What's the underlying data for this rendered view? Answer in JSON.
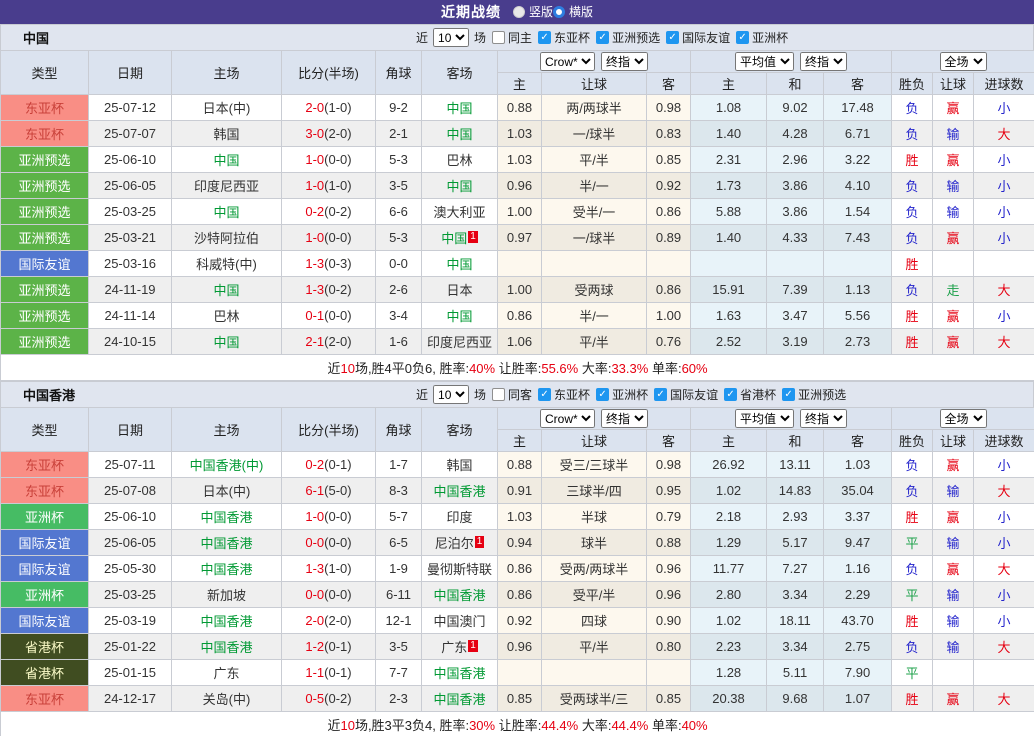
{
  "titlebar": {
    "title": "近期战绩",
    "radios": [
      {
        "label": "竖版",
        "checked": false
      },
      {
        "label": "横版",
        "checked": true
      }
    ]
  },
  "columns": {
    "left": [
      "类型",
      "日期",
      "主场",
      "比分(半场)",
      "角球",
      "客场"
    ],
    "groups": [
      {
        "selects": [
          "Crow*",
          "终指"
        ],
        "subs": [
          "主",
          "让球",
          "客"
        ]
      },
      {
        "selects": [
          "平均值",
          "终指"
        ],
        "subs": [
          "主",
          "和",
          "客"
        ]
      },
      {
        "selects": [
          "全场"
        ],
        "subs": [
          "胜负",
          "让球",
          "进球数"
        ]
      }
    ]
  },
  "type_colors": {
    "东亚杯": {
      "bg": "#f98e85",
      "fg": "#c9413a"
    },
    "亚洲预选": {
      "bg": "#5cb348",
      "fg": "#ffffff"
    },
    "亚洲杯": {
      "bg": "#46bc64",
      "fg": "#ffffff"
    },
    "国际友谊": {
      "bg": "#5377d0",
      "fg": "#ffffff"
    },
    "省港杯": {
      "bg": "#404d21",
      "fg": "#fbfbc8"
    }
  },
  "value_colors": {
    "胜": "red",
    "负": "blue",
    "平": "green",
    "赢": "red",
    "输": "blue",
    "走": "green",
    "大": "red",
    "小": "blue"
  },
  "sections": [
    {
      "team": "中国",
      "filter": {
        "near": "近",
        "count": "10",
        "unit": "场",
        "same": {
          "label": "同主",
          "checked": false
        },
        "comps": [
          "东亚杯",
          "亚洲预选",
          "国际友谊",
          "亚洲杯"
        ]
      },
      "rows": [
        {
          "t": "东亚杯",
          "d": "25-07-12",
          "h": "日本(中)",
          "hg": false,
          "hb": "",
          "s": "2-0",
          "sh": "(1-0)",
          "ck": "9-2",
          "a": "中国",
          "ag": true,
          "ab": "",
          "o1": "0.88",
          "o2": "两/两球半",
          "o3": "0.98",
          "v1": "1.08",
          "v2": "9.02",
          "v3": "17.48",
          "r1": "负",
          "r2": "赢",
          "r3": "小"
        },
        {
          "t": "东亚杯",
          "d": "25-07-07",
          "h": "韩国",
          "hg": false,
          "hb": "",
          "s": "3-0",
          "sh": "(2-0)",
          "ck": "2-1",
          "a": "中国",
          "ag": true,
          "ab": "",
          "o1": "1.03",
          "o2": "一/球半",
          "o3": "0.83",
          "v1": "1.40",
          "v2": "4.28",
          "v3": "6.71",
          "r1": "负",
          "r2": "输",
          "r3": "大"
        },
        {
          "t": "亚洲预选",
          "d": "25-06-10",
          "h": "中国",
          "hg": true,
          "hb": "",
          "s": "1-0",
          "sh": "(0-0)",
          "ck": "5-3",
          "a": "巴林",
          "ag": false,
          "ab": "",
          "o1": "1.03",
          "o2": "平/半",
          "o3": "0.85",
          "v1": "2.31",
          "v2": "2.96",
          "v3": "3.22",
          "r1": "胜",
          "r2": "赢",
          "r3": "小"
        },
        {
          "t": "亚洲预选",
          "d": "25-06-05",
          "h": "印度尼西亚",
          "hg": false,
          "hb": "",
          "s": "1-0",
          "sh": "(1-0)",
          "ck": "3-5",
          "a": "中国",
          "ag": true,
          "ab": "",
          "o1": "0.96",
          "o2": "半/一",
          "o3": "0.92",
          "v1": "1.73",
          "v2": "3.86",
          "v3": "4.10",
          "r1": "负",
          "r2": "输",
          "r3": "小"
        },
        {
          "t": "亚洲预选",
          "d": "25-03-25",
          "h": "中国",
          "hg": true,
          "hb": "",
          "s": "0-2",
          "sh": "(0-2)",
          "ck": "6-6",
          "a": "澳大利亚",
          "ag": false,
          "ab": "",
          "o1": "1.00",
          "o2": "受半/一",
          "o3": "0.86",
          "v1": "5.88",
          "v2": "3.86",
          "v3": "1.54",
          "r1": "负",
          "r2": "输",
          "r3": "小"
        },
        {
          "t": "亚洲预选",
          "d": "25-03-21",
          "h": "沙特阿拉伯",
          "hg": false,
          "hb": "",
          "s": "1-0",
          "sh": "(0-0)",
          "ck": "5-3",
          "a": "中国",
          "ag": true,
          "ab": "1",
          "o1": "0.97",
          "o2": "一/球半",
          "o3": "0.89",
          "v1": "1.40",
          "v2": "4.33",
          "v3": "7.43",
          "r1": "负",
          "r2": "赢",
          "r3": "小"
        },
        {
          "t": "国际友谊",
          "d": "25-03-16",
          "h": "科威特(中)",
          "hg": false,
          "hb": "",
          "s": "1-3",
          "sh": "(0-3)",
          "ck": "0-0",
          "a": "中国",
          "ag": true,
          "ab": "",
          "o1": "",
          "o2": "",
          "o3": "",
          "v1": "",
          "v2": "",
          "v3": "",
          "r1": "胜",
          "r2": "",
          "r3": ""
        },
        {
          "t": "亚洲预选",
          "d": "24-11-19",
          "h": "中国",
          "hg": true,
          "hb": "",
          "s": "1-3",
          "sh": "(0-2)",
          "ck": "2-6",
          "a": "日本",
          "ag": false,
          "ab": "",
          "o1": "1.00",
          "o2": "受两球",
          "o3": "0.86",
          "v1": "15.91",
          "v2": "7.39",
          "v3": "1.13",
          "r1": "负",
          "r2": "走",
          "r3": "大"
        },
        {
          "t": "亚洲预选",
          "d": "24-11-14",
          "h": "巴林",
          "hg": false,
          "hb": "",
          "s": "0-1",
          "sh": "(0-0)",
          "ck": "3-4",
          "a": "中国",
          "ag": true,
          "ab": "",
          "o1": "0.86",
          "o2": "半/一",
          "o3": "1.00",
          "v1": "1.63",
          "v2": "3.47",
          "v3": "5.56",
          "r1": "胜",
          "r2": "赢",
          "r3": "小"
        },
        {
          "t": "亚洲预选",
          "d": "24-10-15",
          "h": "中国",
          "hg": true,
          "hb": "",
          "s": "2-1",
          "sh": "(2-0)",
          "ck": "1-6",
          "a": "印度尼西亚",
          "ag": false,
          "ab": "",
          "o1": "1.06",
          "o2": "平/半",
          "o3": "0.76",
          "v1": "2.52",
          "v2": "3.19",
          "v3": "2.73",
          "r1": "胜",
          "r2": "赢",
          "r3": "大"
        }
      ],
      "summary": [
        {
          "text": "近",
          "red": false
        },
        {
          "text": "10",
          "red": true
        },
        {
          "text": "场,胜4平0负6, 胜率:",
          "red": false
        },
        {
          "text": "40%",
          "red": true
        },
        {
          "text": " 让胜率:",
          "red": false
        },
        {
          "text": "55.6%",
          "red": true
        },
        {
          "text": " 大率:",
          "red": false
        },
        {
          "text": "33.3%",
          "red": true
        },
        {
          "text": " 单率:",
          "red": false
        },
        {
          "text": "60%",
          "red": true
        }
      ]
    },
    {
      "team": "中国香港",
      "filter": {
        "near": "近",
        "count": "10",
        "unit": "场",
        "same": {
          "label": "同客",
          "checked": false
        },
        "comps": [
          "东亚杯",
          "亚洲杯",
          "国际友谊",
          "省港杯",
          "亚洲预选"
        ]
      },
      "rows": [
        {
          "t": "东亚杯",
          "d": "25-07-11",
          "h": "中国香港(中)",
          "hg": true,
          "hb": "",
          "s": "0-2",
          "sh": "(0-1)",
          "ck": "1-7",
          "a": "韩国",
          "ag": false,
          "ab": "",
          "o1": "0.88",
          "o2": "受三/三球半",
          "o3": "0.98",
          "v1": "26.92",
          "v2": "13.11",
          "v3": "1.03",
          "r1": "负",
          "r2": "赢",
          "r3": "小"
        },
        {
          "t": "东亚杯",
          "d": "25-07-08",
          "h": "日本(中)",
          "hg": false,
          "hb": "",
          "s": "6-1",
          "sh": "(5-0)",
          "ck": "8-3",
          "a": "中国香港",
          "ag": true,
          "ab": "",
          "o1": "0.91",
          "o2": "三球半/四",
          "o3": "0.95",
          "v1": "1.02",
          "v2": "14.83",
          "v3": "35.04",
          "r1": "负",
          "r2": "输",
          "r3": "大"
        },
        {
          "t": "亚洲杯",
          "d": "25-06-10",
          "h": "中国香港",
          "hg": true,
          "hb": "",
          "s": "1-0",
          "sh": "(0-0)",
          "ck": "5-7",
          "a": "印度",
          "ag": false,
          "ab": "",
          "o1": "1.03",
          "o2": "半球",
          "o3": "0.79",
          "v1": "2.18",
          "v2": "2.93",
          "v3": "3.37",
          "r1": "胜",
          "r2": "赢",
          "r3": "小"
        },
        {
          "t": "国际友谊",
          "d": "25-06-05",
          "h": "中国香港",
          "hg": true,
          "hb": "",
          "s": "0-0",
          "sh": "(0-0)",
          "ck": "6-5",
          "a": "尼泊尔",
          "ag": false,
          "ab": "1",
          "o1": "0.94",
          "o2": "球半",
          "o3": "0.88",
          "v1": "1.29",
          "v2": "5.17",
          "v3": "9.47",
          "r1": "平",
          "r2": "输",
          "r3": "小"
        },
        {
          "t": "国际友谊",
          "d": "25-05-30",
          "h": "中国香港",
          "hg": true,
          "hb": "",
          "s": "1-3",
          "sh": "(1-0)",
          "ck": "1-9",
          "a": "曼彻斯特联",
          "ag": false,
          "ab": "",
          "o1": "0.86",
          "o2": "受两/两球半",
          "o3": "0.96",
          "v1": "11.77",
          "v2": "7.27",
          "v3": "1.16",
          "r1": "负",
          "r2": "赢",
          "r3": "大"
        },
        {
          "t": "亚洲杯",
          "d": "25-03-25",
          "h": "新加坡",
          "hg": false,
          "hb": "",
          "s": "0-0",
          "sh": "(0-0)",
          "ck": "6-11",
          "a": "中国香港",
          "ag": true,
          "ab": "",
          "o1": "0.86",
          "o2": "受平/半",
          "o3": "0.96",
          "v1": "2.80",
          "v2": "3.34",
          "v3": "2.29",
          "r1": "平",
          "r2": "输",
          "r3": "小"
        },
        {
          "t": "国际友谊",
          "d": "25-03-19",
          "h": "中国香港",
          "hg": true,
          "hb": "",
          "s": "2-0",
          "sh": "(2-0)",
          "ck": "12-1",
          "a": "中国澳门",
          "ag": false,
          "ab": "",
          "o1": "0.92",
          "o2": "四球",
          "o3": "0.90",
          "v1": "1.02",
          "v2": "18.11",
          "v3": "43.70",
          "r1": "胜",
          "r2": "输",
          "r3": "小"
        },
        {
          "t": "省港杯",
          "d": "25-01-22",
          "h": "中国香港",
          "hg": true,
          "hb": "",
          "s": "1-2",
          "sh": "(0-1)",
          "ck": "3-5",
          "a": "广东",
          "ag": false,
          "ab": "1",
          "o1": "0.96",
          "o2": "平/半",
          "o3": "0.80",
          "v1": "2.23",
          "v2": "3.34",
          "v3": "2.75",
          "r1": "负",
          "r2": "输",
          "r3": "大"
        },
        {
          "t": "省港杯",
          "d": "25-01-15",
          "h": "广东",
          "hg": false,
          "hb": "",
          "s": "1-1",
          "sh": "(0-1)",
          "ck": "7-7",
          "a": "中国香港",
          "ag": true,
          "ab": "",
          "o1": "",
          "o2": "",
          "o3": "",
          "v1": "1.28",
          "v2": "5.11",
          "v3": "7.90",
          "r1": "平",
          "r2": "",
          "r3": ""
        },
        {
          "t": "东亚杯",
          "d": "24-12-17",
          "h": "关岛(中)",
          "hg": false,
          "hb": "",
          "s": "0-5",
          "sh": "(0-2)",
          "ck": "2-3",
          "a": "中国香港",
          "ag": true,
          "ab": "",
          "o1": "0.85",
          "o2": "受两球半/三",
          "o3": "0.85",
          "v1": "20.38",
          "v2": "9.68",
          "v3": "1.07",
          "r1": "胜",
          "r2": "赢",
          "r3": "大"
        }
      ],
      "summary": [
        {
          "text": "近",
          "red": false
        },
        {
          "text": "10",
          "red": true
        },
        {
          "text": "场,胜3平3负4, 胜率:",
          "red": false
        },
        {
          "text": "30%",
          "red": true
        },
        {
          "text": " 让胜率:",
          "red": false
        },
        {
          "text": "44.4%",
          "red": true
        },
        {
          "text": " 大率:",
          "red": false
        },
        {
          "text": "44.4%",
          "red": true
        },
        {
          "text": " 单率:",
          "red": false
        },
        {
          "text": "40%",
          "red": true
        }
      ]
    }
  ]
}
